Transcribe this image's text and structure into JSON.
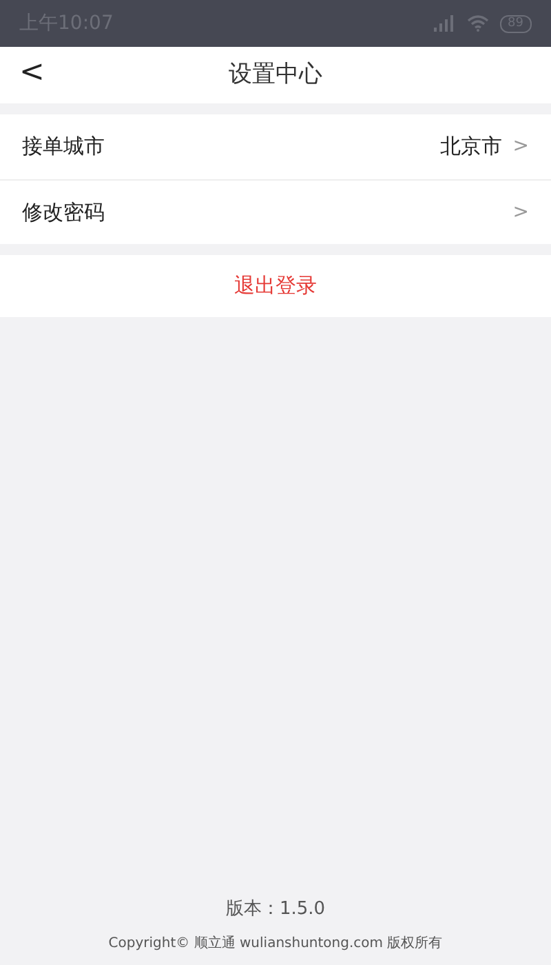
{
  "status_bar": {
    "time": "上午10:07",
    "battery": "89"
  },
  "nav": {
    "back": "<",
    "title": "设置中心"
  },
  "settings": [
    {
      "label": "接单城市",
      "value": "北京市",
      "chevron": ">"
    },
    {
      "label": "修改密码",
      "chevron": ">"
    }
  ],
  "logout": "退出登录",
  "footer": {
    "version": "版本：1.5.0",
    "copyright": "Copyright© 顺立通 wulianshuntong.com 版权所有"
  }
}
